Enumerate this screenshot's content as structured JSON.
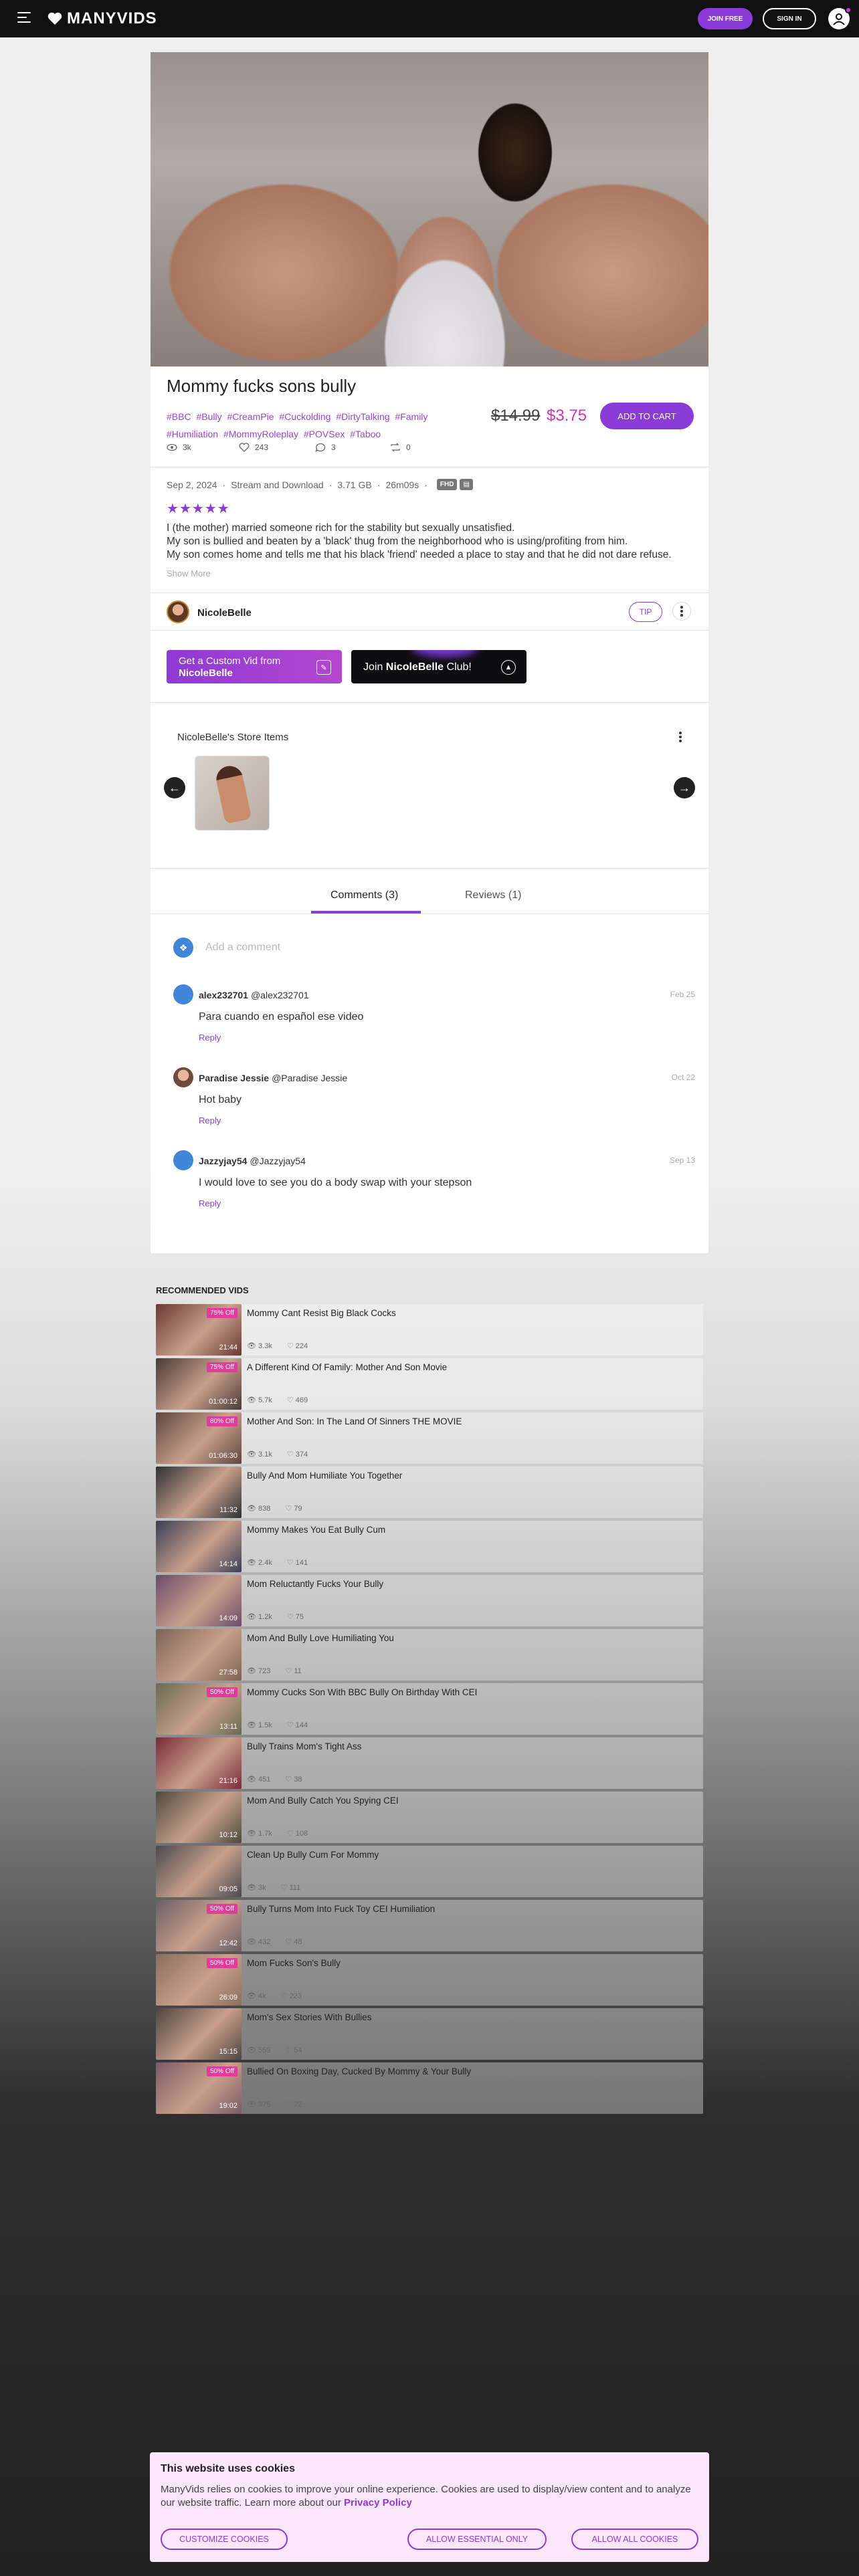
{
  "header": {
    "logo_text": "MANYVIDS",
    "join_label": "JOIN FREE",
    "signin_label": "SIGN IN"
  },
  "video": {
    "title": "Mommy fucks sons bully",
    "tags": [
      "#BBC",
      "#Bully",
      "#CreamPie",
      "#Cuckolding",
      "#DirtyTalking",
      "#Family",
      "#Humiliation",
      "#MommyRoleplay",
      "#POVSex",
      "#Taboo"
    ],
    "price_old": "$14.99",
    "price_new": "$3.75",
    "add_to_cart": "ADD TO CART",
    "views": "3k",
    "likes": "243",
    "comments": "3",
    "shares": "0",
    "date": "Sep 2, 2024",
    "delivery": "Stream and Download",
    "size": "3.71 GB",
    "duration": "26m09s",
    "quality_badge": "FHD",
    "rating": 5,
    "description": [
      "I (the mother) married someone rich for the stability but sexually unsatisfied.",
      "My son is bullied and beaten by a 'black' thug from the neighborhood who is using/profiting from him.",
      "My son comes home and tells me that his black 'friend' needed a place to stay and that he did not dare refuse."
    ],
    "show_more": "Show More"
  },
  "creator": {
    "name": "NicoleBelle",
    "tip_label": "TIP",
    "custom_line1": "Get a Custom Vid from",
    "custom_line2": "NicoleBelle",
    "club_prefix": "Join ",
    "club_name": "NicoleBelle",
    "club_suffix": " Club!"
  },
  "store": {
    "title": "NicoleBelle's Store Items"
  },
  "tabs": {
    "comments": "Comments (3)",
    "reviews": "Reviews (1)"
  },
  "comment_placeholder": "Add a comment",
  "comments": [
    {
      "name": "alex232701",
      "handle": "@alex232701",
      "date": "Feb 25",
      "text": "Para cuando en español ese video",
      "reply": "Reply"
    },
    {
      "name": "Paradise Jessie",
      "handle": "@Paradise Jessie",
      "date": "Oct 22",
      "text": "Hot baby",
      "reply": "Reply"
    },
    {
      "name": "Jazzyjay54",
      "handle": "@Jazzyjay54",
      "date": "Sep 13",
      "text": "I would love to see you do a body swap with your stepson",
      "reply": "Reply"
    }
  ],
  "recommended": {
    "title": "RECOMMENDED VIDS",
    "items": [
      {
        "title": "Mommy Cant Resist Big Black Cocks",
        "discount": "75% Off",
        "duration": "21:44",
        "views": "3.3k",
        "likes": "224"
      },
      {
        "title": "A Different Kind Of Family: Mother And Son Movie",
        "discount": "75% Off",
        "duration": "01:00:12",
        "views": "5.7k",
        "likes": "469"
      },
      {
        "title": "Mother And Son: In The Land Of Sinners THE MOVIE",
        "discount": "80% Off",
        "duration": "01:06:30",
        "views": "3.1k",
        "likes": "374"
      },
      {
        "title": "Bully And Mom Humiliate You Together",
        "discount": "",
        "duration": "11:32",
        "views": "838",
        "likes": "79"
      },
      {
        "title": "Mommy Makes You Eat Bully Cum",
        "discount": "",
        "duration": "14:14",
        "views": "2.4k",
        "likes": "141"
      },
      {
        "title": "Mom Reluctantly Fucks Your Bully",
        "discount": "",
        "duration": "14:09",
        "views": "1.2k",
        "likes": "75"
      },
      {
        "title": "Mom And Bully Love Humiliating You",
        "discount": "",
        "duration": "27:58",
        "views": "723",
        "likes": "11"
      },
      {
        "title": "Mommy Cucks Son With BBC Bully On Birthday With CEI",
        "discount": "50% Off",
        "duration": "13:11",
        "views": "1.5k",
        "likes": "144"
      },
      {
        "title": "Bully Trains Mom's Tight Ass",
        "discount": "",
        "duration": "21:16",
        "views": "451",
        "likes": "38"
      },
      {
        "title": "Mom And Bully Catch You Spying CEI",
        "discount": "",
        "duration": "10:12",
        "views": "1.7k",
        "likes": "108"
      },
      {
        "title": "Clean Up Bully Cum For Mommy",
        "discount": "",
        "duration": "09:05",
        "views": "3k",
        "likes": "111"
      },
      {
        "title": "Bully Turns Mom Into Fuck Toy CEI Humiliation",
        "discount": "50% Off",
        "duration": "12:42",
        "views": "432",
        "likes": "48"
      },
      {
        "title": "Mom Fucks Son's Bully",
        "discount": "50% Off",
        "duration": "26:09",
        "views": "4k",
        "likes": "223"
      },
      {
        "title": "Mom's Sex Stories With Bullies",
        "discount": "",
        "duration": "15:15",
        "views": "559",
        "likes": "54"
      },
      {
        "title": "Bullied On Boxing Day, Cucked By Mommy & Your Bully",
        "discount": "50% Off",
        "duration": "19:02",
        "views": "375",
        "likes": "22"
      }
    ]
  },
  "cookie": {
    "title": "This website uses cookies",
    "text": "ManyVids relies on cookies to improve your online experience. Cookies are used to display/view content and to analyze our website traffic. Learn more about our ",
    "link": "Privacy Policy",
    "customize": "CUSTOMIZE COOKIES",
    "essential": "ALLOW ESSENTIAL ONLY",
    "all": "ALLOW ALL COOKIES"
  },
  "colors": {
    "accent": "#8b3bd8",
    "price": "#d130b9",
    "discount_badge": "#e13c9c",
    "header_bg": "#111111"
  }
}
